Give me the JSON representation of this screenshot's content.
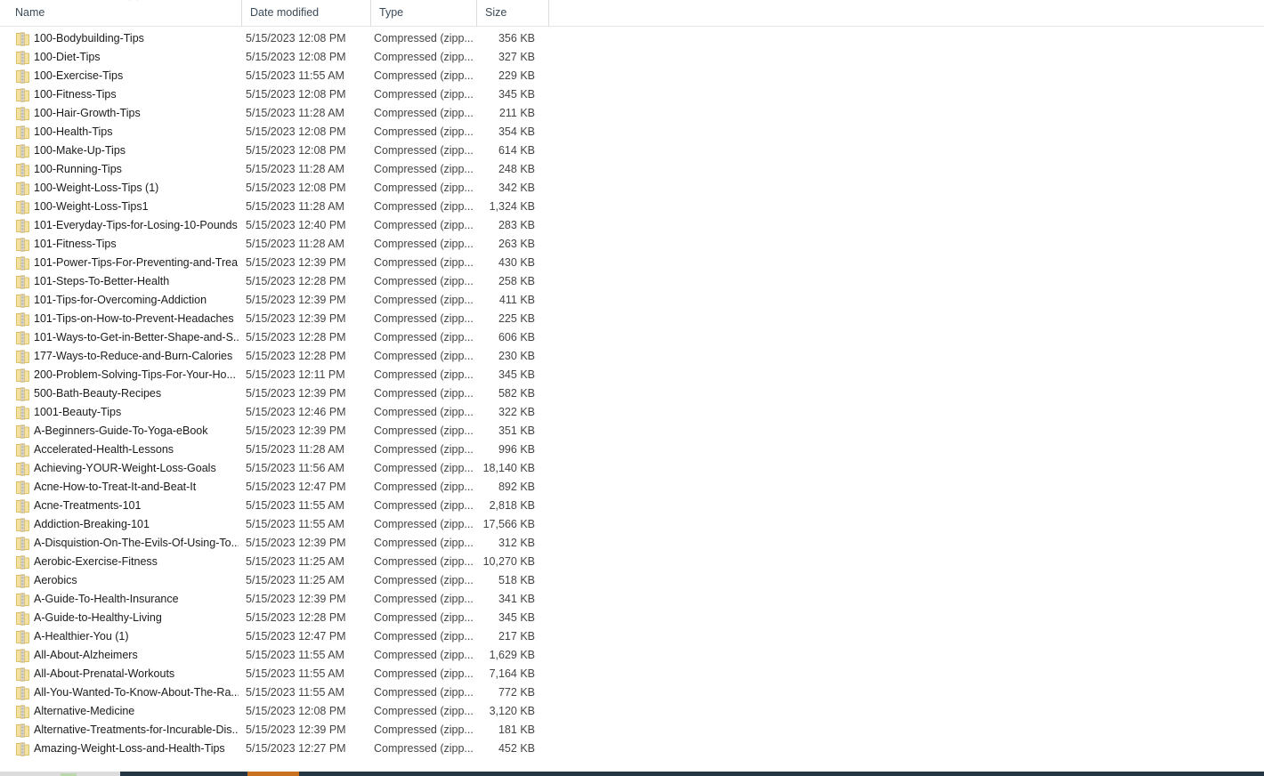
{
  "window": {
    "view_mode": "details"
  },
  "columns": {
    "name": {
      "label": "Name",
      "sort_indicator": "˄"
    },
    "date_modified": {
      "label": "Date modified"
    },
    "type": {
      "label": "Type"
    },
    "size": {
      "label": "Size"
    }
  },
  "files": [
    {
      "name": "100-Bodybuilding-Tips",
      "date": "5/15/2023 12:08 PM",
      "type": "Compressed (zipp...",
      "size": "356 KB",
      "icon": "zip-file-icon"
    },
    {
      "name": "100-Diet-Tips",
      "date": "5/15/2023 12:08 PM",
      "type": "Compressed (zipp...",
      "size": "327 KB",
      "icon": "zip-file-icon"
    },
    {
      "name": "100-Exercise-Tips",
      "date": "5/15/2023 11:55 AM",
      "type": "Compressed (zipp...",
      "size": "229 KB",
      "icon": "zip-file-icon"
    },
    {
      "name": "100-Fitness-Tips",
      "date": "5/15/2023 12:08 PM",
      "type": "Compressed (zipp...",
      "size": "345 KB",
      "icon": "zip-file-icon"
    },
    {
      "name": "100-Hair-Growth-Tips",
      "date": "5/15/2023 11:28 AM",
      "type": "Compressed (zipp...",
      "size": "211 KB",
      "icon": "zip-file-icon"
    },
    {
      "name": "100-Health-Tips",
      "date": "5/15/2023 12:08 PM",
      "type": "Compressed (zipp...",
      "size": "354 KB",
      "icon": "zip-file-icon"
    },
    {
      "name": "100-Make-Up-Tips",
      "date": "5/15/2023 12:08 PM",
      "type": "Compressed (zipp...",
      "size": "614 KB",
      "icon": "zip-file-icon"
    },
    {
      "name": "100-Running-Tips",
      "date": "5/15/2023 11:28 AM",
      "type": "Compressed (zipp...",
      "size": "248 KB",
      "icon": "zip-file-icon"
    },
    {
      "name": "100-Weight-Loss-Tips (1)",
      "date": "5/15/2023 12:08 PM",
      "type": "Compressed (zipp...",
      "size": "342 KB",
      "icon": "zip-file-icon"
    },
    {
      "name": "100-Weight-Loss-Tips1",
      "date": "5/15/2023 11:28 AM",
      "type": "Compressed (zipp...",
      "size": "1,324 KB",
      "icon": "zip-file-icon"
    },
    {
      "name": "101-Everyday-Tips-for-Losing-10-Pounds",
      "date": "5/15/2023 12:40 PM",
      "type": "Compressed (zipp...",
      "size": "283 KB",
      "icon": "zip-file-icon"
    },
    {
      "name": "101-Fitness-Tips",
      "date": "5/15/2023 11:28 AM",
      "type": "Compressed (zipp...",
      "size": "263 KB",
      "icon": "zip-file-icon"
    },
    {
      "name": "101-Power-Tips-For-Preventing-and-Trea...",
      "date": "5/15/2023 12:39 PM",
      "type": "Compressed (zipp...",
      "size": "430 KB",
      "icon": "zip-file-icon"
    },
    {
      "name": "101-Steps-To-Better-Health",
      "date": "5/15/2023 12:28 PM",
      "type": "Compressed (zipp...",
      "size": "258 KB",
      "icon": "zip-file-icon"
    },
    {
      "name": "101-Tips-for-Overcoming-Addiction",
      "date": "5/15/2023 12:39 PM",
      "type": "Compressed (zipp...",
      "size": "411 KB",
      "icon": "zip-file-icon"
    },
    {
      "name": "101-Tips-on-How-to-Prevent-Headaches",
      "date": "5/15/2023 12:39 PM",
      "type": "Compressed (zipp...",
      "size": "225 KB",
      "icon": "zip-file-icon"
    },
    {
      "name": "101-Ways-to-Get-in-Better-Shape-and-S...",
      "date": "5/15/2023 12:28 PM",
      "type": "Compressed (zipp...",
      "size": "606 KB",
      "icon": "zip-file-icon"
    },
    {
      "name": "177-Ways-to-Reduce-and-Burn-Calories",
      "date": "5/15/2023 12:28 PM",
      "type": "Compressed (zipp...",
      "size": "230 KB",
      "icon": "zip-file-icon"
    },
    {
      "name": "200-Problem-Solving-Tips-For-Your-Ho...",
      "date": "5/15/2023 12:11 PM",
      "type": "Compressed (zipp...",
      "size": "345 KB",
      "icon": "zip-file-icon"
    },
    {
      "name": "500-Bath-Beauty-Recipes",
      "date": "5/15/2023 12:39 PM",
      "type": "Compressed (zipp...",
      "size": "582 KB",
      "icon": "zip-file-icon"
    },
    {
      "name": "1001-Beauty-Tips",
      "date": "5/15/2023 12:46 PM",
      "type": "Compressed (zipp...",
      "size": "322 KB",
      "icon": "zip-file-icon"
    },
    {
      "name": "A-Beginners-Guide-To-Yoga-eBook",
      "date": "5/15/2023 12:39 PM",
      "type": "Compressed (zipp...",
      "size": "351 KB",
      "icon": "zip-file-icon"
    },
    {
      "name": "Accelerated-Health-Lessons",
      "date": "5/15/2023 11:28 AM",
      "type": "Compressed (zipp...",
      "size": "996 KB",
      "icon": "zip-file-icon"
    },
    {
      "name": "Achieving-YOUR-Weight-Loss-Goals",
      "date": "5/15/2023 11:56 AM",
      "type": "Compressed (zipp...",
      "size": "18,140 KB",
      "icon": "zip-file-icon"
    },
    {
      "name": "Acne-How-to-Treat-It-and-Beat-It",
      "date": "5/15/2023 12:47 PM",
      "type": "Compressed (zipp...",
      "size": "892 KB",
      "icon": "zip-file-icon"
    },
    {
      "name": "Acne-Treatments-101",
      "date": "5/15/2023 11:55 AM",
      "type": "Compressed (zipp...",
      "size": "2,818 KB",
      "icon": "zip-file-icon"
    },
    {
      "name": "Addiction-Breaking-101",
      "date": "5/15/2023 11:55 AM",
      "type": "Compressed (zipp...",
      "size": "17,566 KB",
      "icon": "zip-file-icon"
    },
    {
      "name": "A-Disquistion-On-The-Evils-Of-Using-To...",
      "date": "5/15/2023 12:39 PM",
      "type": "Compressed (zipp...",
      "size": "312 KB",
      "icon": "zip-file-icon"
    },
    {
      "name": "Aerobic-Exercise-Fitness",
      "date": "5/15/2023 11:25 AM",
      "type": "Compressed (zipp...",
      "size": "10,270 KB",
      "icon": "zip-file-icon"
    },
    {
      "name": "Aerobics",
      "date": "5/15/2023 11:25 AM",
      "type": "Compressed (zipp...",
      "size": "518 KB",
      "icon": "zip-file-icon"
    },
    {
      "name": "A-Guide-To-Health-Insurance",
      "date": "5/15/2023 12:39 PM",
      "type": "Compressed (zipp...",
      "size": "341 KB",
      "icon": "zip-file-icon"
    },
    {
      "name": "A-Guide-to-Healthy-Living",
      "date": "5/15/2023 12:28 PM",
      "type": "Compressed (zipp...",
      "size": "345 KB",
      "icon": "zip-file-icon"
    },
    {
      "name": "A-Healthier-You (1)",
      "date": "5/15/2023 12:47 PM",
      "type": "Compressed (zipp...",
      "size": "217 KB",
      "icon": "zip-file-icon"
    },
    {
      "name": "All-About-Alzheimers",
      "date": "5/15/2023 11:55 AM",
      "type": "Compressed (zipp...",
      "size": "1,629 KB",
      "icon": "zip-file-icon"
    },
    {
      "name": "All-About-Prenatal-Workouts",
      "date": "5/15/2023 11:55 AM",
      "type": "Compressed (zipp...",
      "size": "7,164 KB",
      "icon": "zip-file-icon"
    },
    {
      "name": "All-You-Wanted-To-Know-About-The-Ra...",
      "date": "5/15/2023 11:55 AM",
      "type": "Compressed (zipp...",
      "size": "772 KB",
      "icon": "zip-file-icon"
    },
    {
      "name": "Alternative-Medicine",
      "date": "5/15/2023 12:08 PM",
      "type": "Compressed (zipp...",
      "size": "3,120 KB",
      "icon": "zip-file-icon"
    },
    {
      "name": "Alternative-Treatments-for-Incurable-Dis...",
      "date": "5/15/2023 12:39 PM",
      "type": "Compressed (zipp...",
      "size": "181 KB",
      "icon": "zip-file-icon"
    },
    {
      "name": "Amazing-Weight-Loss-and-Health-Tips",
      "date": "5/15/2023 12:27 PM",
      "type": "Compressed (zipp...",
      "size": "452 KB",
      "icon": "zip-file-icon"
    }
  ],
  "colors": {
    "header_text": "#3b4a57",
    "row_text": "#1b1b1b",
    "secondary_text": "#444444",
    "zip_icon_body": "#f2d98c",
    "taskbar_dark": "#253544",
    "taskbar_accent": "#c9711e"
  }
}
